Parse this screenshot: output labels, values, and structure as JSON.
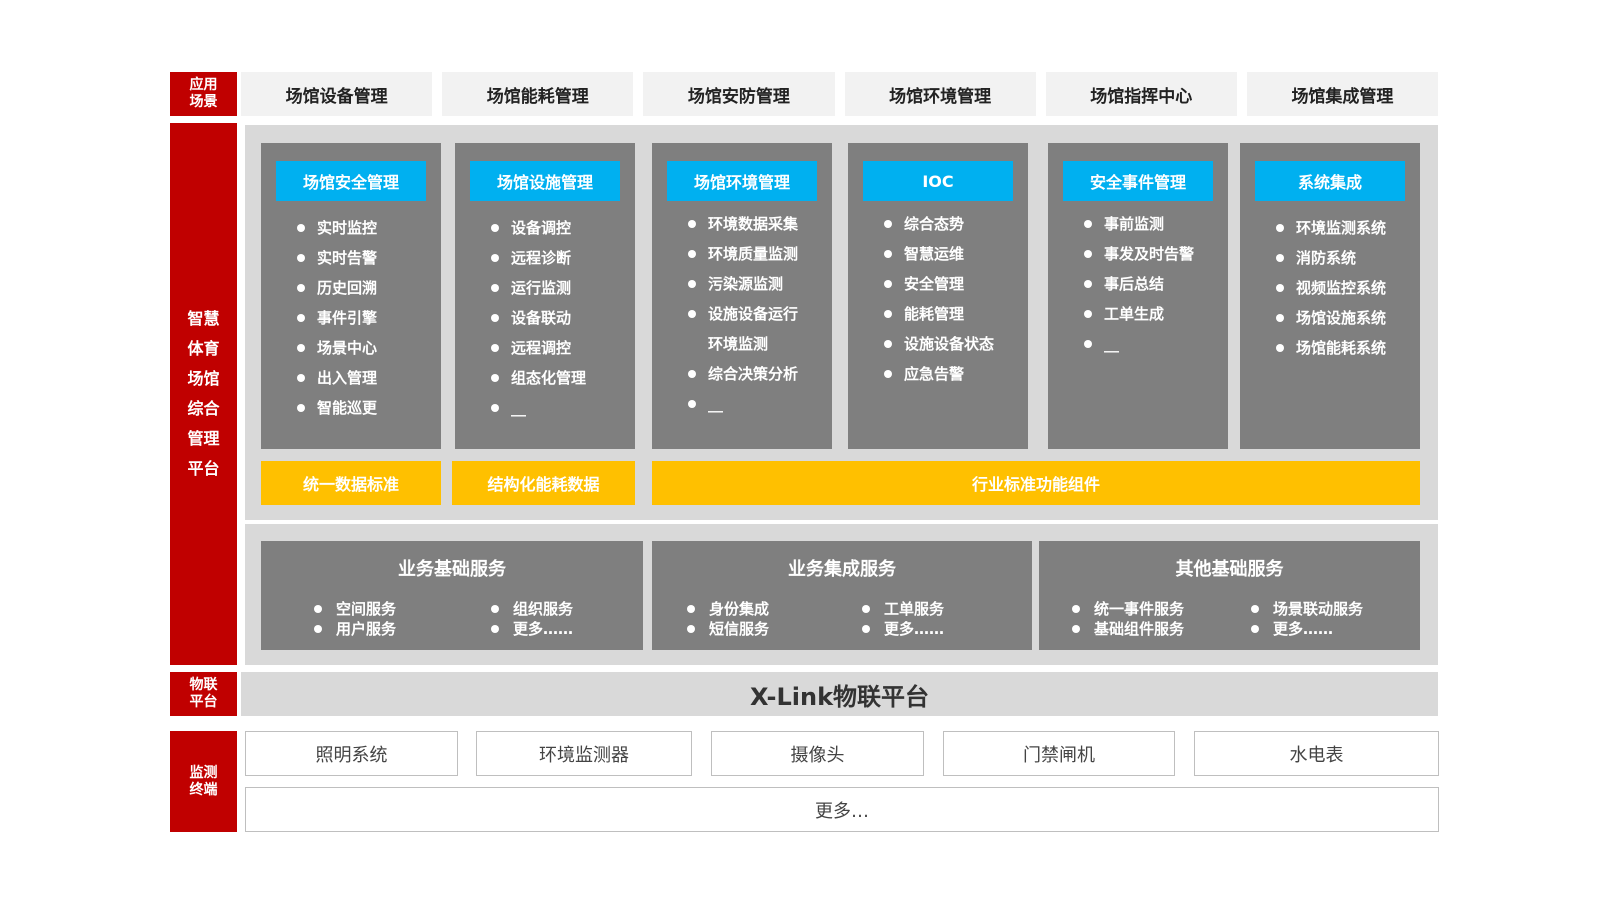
{
  "side_labels": {
    "scene": "应用\n场景",
    "platform": "智慧\n体育\n场馆\n综合\n管理\n平台",
    "iot": "物联\n平台",
    "terminal": "监测\n终端"
  },
  "scenes": [
    "场馆设备管理",
    "场馆能耗管理",
    "场馆安防管理",
    "场馆环境管理",
    "场馆指挥中心",
    "场馆集成管理"
  ],
  "modules": [
    {
      "title": "场馆安全管理",
      "items": [
        "实时监控",
        "实时告警",
        "历史回溯",
        "事件引擎",
        "场景中心",
        "出入管理",
        "智能巡更"
      ]
    },
    {
      "title": "场馆设施管理",
      "items": [
        "设备调控",
        "远程诊断",
        "运行监测",
        "设备联动",
        "远程调控",
        "组态化管理",
        "__"
      ]
    },
    {
      "title": "场馆环境管理",
      "items": [
        "环境数据采集",
        "环境质量监测",
        "污染源监测",
        "设施设备运行",
        "环境监测",
        "综合决策分析",
        "__"
      ]
    },
    {
      "title": "IOC",
      "items": [
        "综合态势",
        "智慧运维",
        "安全管理",
        "能耗管理",
        "设施设备状态",
        "应急告警"
      ]
    },
    {
      "title": "安全事件管理",
      "items": [
        "事前监测",
        "事发及时告警",
        "事后总结",
        "工单生成",
        "__"
      ]
    },
    {
      "title": "系统集成",
      "items": [
        "环境监测系统",
        "消防系统",
        "视频监控系统",
        "场馆设施系统",
        "场馆能耗系统"
      ]
    }
  ],
  "components": [
    "统一数据标准",
    "结构化能耗数据",
    "行业标准功能组件"
  ],
  "services": [
    {
      "title": "业务基础服务",
      "left": [
        "空间服务",
        "用户服务"
      ],
      "right": [
        "组织服务",
        "更多……"
      ]
    },
    {
      "title": "业务集成服务",
      "left": [
        "身份集成",
        "短信服务"
      ],
      "right": [
        "工单服务",
        "更多……"
      ]
    },
    {
      "title": "其他基础服务",
      "left": [
        "统一事件服务",
        "基础组件服务"
      ],
      "right": [
        "场景联动服务",
        "更多……"
      ]
    }
  ],
  "iot_platform": "X-Link物联平台",
  "terminals": [
    "照明系统",
    "环境监测器",
    "摄像头",
    "门禁闸机",
    "水电表"
  ],
  "terminals_more": "更多…",
  "colors": {
    "red": "#c00000",
    "blue": "#00b0f0",
    "yellow": "#ffc000",
    "dark_gray": "#7f7f7f",
    "light_gray": "#d9d9d9"
  }
}
